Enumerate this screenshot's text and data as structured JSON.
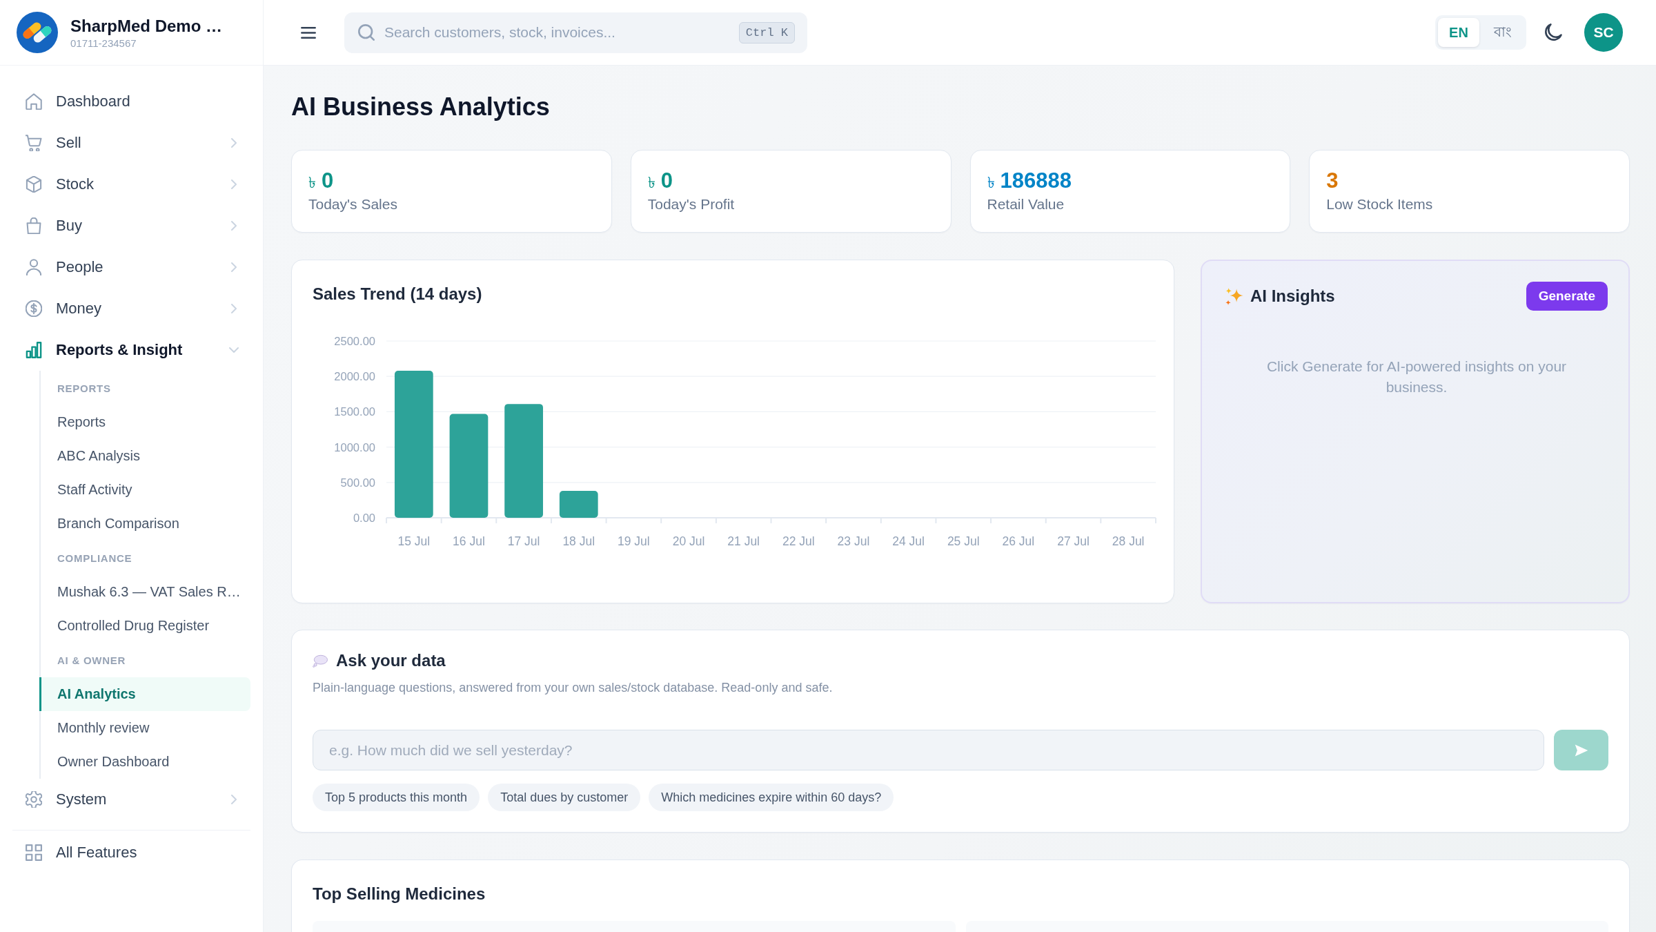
{
  "sidebar": {
    "brand": {
      "name": "SharpMed Demo …",
      "phone": "01711-234567"
    },
    "items": [
      {
        "label": "Dashboard",
        "kind": "link"
      },
      {
        "label": "Sell",
        "kind": "group",
        "expanded": false
      },
      {
        "label": "Stock",
        "kind": "group",
        "expanded": false
      },
      {
        "label": "Buy",
        "kind": "group",
        "expanded": false
      },
      {
        "label": "People",
        "kind": "group",
        "expanded": false
      },
      {
        "label": "Money",
        "kind": "group",
        "expanded": false
      },
      {
        "label": "Reports & Insight",
        "kind": "group",
        "expanded": true,
        "children": [
          {
            "heading": "REPORTS",
            "children": [
              {
                "label": "Reports",
                "selected": false
              },
              {
                "label": "ABC Analysis",
                "selected": false
              },
              {
                "label": "Staff Activity",
                "selected": false
              },
              {
                "label": "Branch Comparison",
                "selected": false
              }
            ]
          },
          {
            "heading": "COMPLIANCE",
            "children": [
              {
                "label": "Mushak 6.3 — VAT Sales R…",
                "selected": false
              },
              {
                "label": "Controlled Drug Register",
                "selected": false
              }
            ]
          },
          {
            "heading": "AI & OWNER",
            "children": [
              {
                "label": "AI Analytics",
                "selected": true
              },
              {
                "label": "Monthly review",
                "selected": false
              },
              {
                "label": "Owner Dashboard",
                "selected": false
              }
            ]
          }
        ]
      },
      {
        "label": "System",
        "kind": "group",
        "expanded": false
      }
    ],
    "footer_items": [
      {
        "label": "All Features"
      }
    ]
  },
  "top_bar": {
    "search": {
      "placeholder": "Search customers, stock, invoices...",
      "shortcut": "Ctrl K"
    },
    "languages": [
      {
        "label": "EN",
        "selected": true
      },
      {
        "label": "বাং",
        "selected": false
      }
    ],
    "avatar": {
      "initials": "SC"
    }
  },
  "page": {
    "title": "AI Business Analytics"
  },
  "stats": [
    {
      "currency": "৳",
      "value": "0",
      "label": "Today's Sales",
      "color": "#0d9488"
    },
    {
      "currency": "৳",
      "value": "0",
      "label": "Today's Profit",
      "color": "#0d9488"
    },
    {
      "currency": "৳",
      "value": "186888",
      "label": "Retail Value",
      "color": "#0284c7"
    },
    {
      "value": "3",
      "label": "Low Stock Items",
      "color": "#d97706"
    }
  ],
  "sales_trend": {
    "chart_data": {
      "type": "bar",
      "title": "Sales Trend (14 days)",
      "categories": [
        "15 Jul",
        "16 Jul",
        "17 Jul",
        "18 Jul",
        "19 Jul",
        "20 Jul",
        "21 Jul",
        "22 Jul",
        "23 Jul",
        "24 Jul",
        "25 Jul",
        "26 Jul",
        "27 Jul",
        "28 Jul"
      ],
      "values": [
        2080,
        1470,
        1610,
        380,
        0,
        0,
        0,
        0,
        0,
        0,
        0,
        0,
        0,
        0
      ],
      "ylim": [
        0,
        2500
      ],
      "yticks": [
        {
          "value": 0,
          "label": "0.00"
        },
        {
          "value": 500,
          "label": "500.00"
        },
        {
          "value": 1000,
          "label": "1000.00"
        },
        {
          "value": 1500,
          "label": "1500.00"
        },
        {
          "value": 2000,
          "label": "2000.00"
        },
        {
          "value": 2500,
          "label": "2500.00"
        }
      ],
      "grid": true
    }
  },
  "ai_insights": {
    "title": "AI Insights",
    "button": "Generate",
    "message": "Click Generate for AI-powered insights on your business."
  },
  "ask_your_data": {
    "title": "Ask your data",
    "subtitle": "Plain-language questions, answered from your own sales/stock database. Read-only and safe.",
    "input": {
      "placeholder": "e.g. How much did we sell yesterday?"
    },
    "send_button": {
      "disabled": true
    },
    "suggestions": [
      "Top 5 products this month",
      "Total dues by customer",
      "Which medicines expire within 60 days?"
    ]
  },
  "top_selling": {
    "title": "Top Selling Medicines"
  }
}
